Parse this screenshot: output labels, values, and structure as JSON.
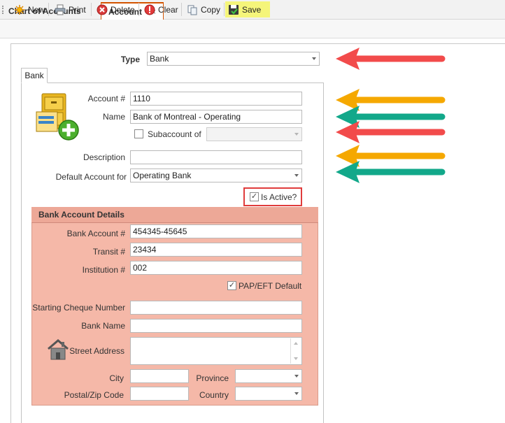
{
  "tabs": {
    "inactive_label": "Chart of Accounts",
    "active_label": "Account",
    "close_glyph": "×"
  },
  "toolbar": {
    "new_label": "New",
    "print_label": "Print",
    "delete_label": "Delete",
    "clear_label": "Clear",
    "copy_label": "Copy",
    "save_label": "Save"
  },
  "form": {
    "type_label": "Type",
    "type_value": "Bank",
    "page_tab": "Bank",
    "account_label": "Account #",
    "account_value": "1110",
    "name_label": "Name",
    "name_value": "Bank of Montreal - Operating",
    "subaccount_label": "Subaccount of",
    "subaccount_value": "",
    "description_label": "Description",
    "description_value": "",
    "default_account_label": "Default Account for",
    "default_account_value": "Operating Bank",
    "is_active_label": "Is Active?",
    "is_active_checked": true,
    "subaccount_checked": false
  },
  "bank": {
    "header": "Bank Account Details",
    "bank_account_label": "Bank Account #",
    "bank_account_value": "454345-45645",
    "transit_label": "Transit #",
    "transit_value": "23434",
    "institution_label": "Institution #",
    "institution_value": "002",
    "pap_label": "PAP/EFT Default",
    "pap_checked": true,
    "cheque_label": "Starting Cheque Number",
    "cheque_value": "",
    "bank_name_label": "Bank Name",
    "bank_name_value": "",
    "street_label": "Street Address",
    "street_value": "",
    "city_label": "City",
    "city_value": "",
    "province_label": "Province",
    "province_value": "",
    "postal_label": "Postal/Zip Code",
    "postal_value": "",
    "country_label": "Country",
    "country_value": ""
  },
  "colors": {
    "arrow_red": "#f24b4b",
    "arrow_orange": "#f5a800",
    "arrow_teal": "#12a88a",
    "highlight_box": "#e03c3c",
    "bank_panel": "#f5b8a8",
    "save_highlight": "#f5f57a",
    "active_tab_border": "#d35400"
  }
}
